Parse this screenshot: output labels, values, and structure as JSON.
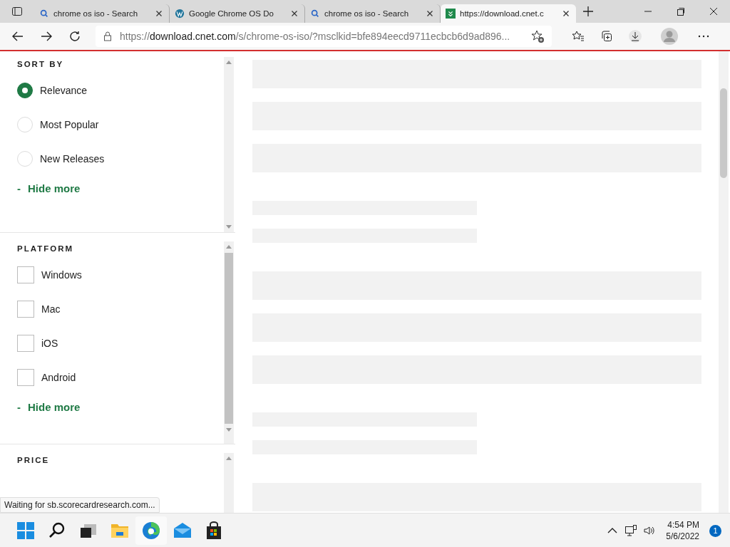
{
  "tabs": [
    {
      "title": "chrome os iso - Search",
      "kind": "search",
      "selected": false
    },
    {
      "title": "Google Chrome OS Do",
      "kind": "wordpress",
      "selected": false
    },
    {
      "title": "chrome os iso - Search",
      "kind": "search",
      "selected": false
    },
    {
      "title": "https://download.cnet.c",
      "kind": "cnet",
      "selected": true
    }
  ],
  "address": {
    "host_prefix": "https://",
    "host": "download.cnet.com",
    "rest": "/s/chrome-os-iso/?msclkid=bfe894eecd9711ecbcb6d9ad896..."
  },
  "filters": [
    {
      "title": "SORT BY",
      "kind": "radio",
      "options": [
        {
          "label": "Relevance",
          "selected": true
        },
        {
          "label": "Most Popular",
          "selected": false
        },
        {
          "label": "New Releases",
          "selected": false
        }
      ],
      "toggle": {
        "sign": "-",
        "label": "Hide more"
      }
    },
    {
      "title": "PLATFORM",
      "kind": "checkbox",
      "options": [
        {
          "label": "Windows",
          "checked": false
        },
        {
          "label": "Mac",
          "checked": false
        },
        {
          "label": "iOS",
          "checked": false
        },
        {
          "label": "Android",
          "checked": false
        }
      ],
      "toggle": {
        "sign": "-",
        "label": "Hide more"
      }
    },
    {
      "title": "PRICE"
    }
  ],
  "placeholders": [
    {
      "kind": "wide"
    },
    {
      "kind": "wide"
    },
    {
      "kind": "wide"
    },
    {
      "kind": "narrow"
    },
    {
      "kind": "narrow"
    },
    {
      "kind": "wide"
    },
    {
      "kind": "wide"
    },
    {
      "kind": "wide"
    },
    {
      "kind": "narrow"
    },
    {
      "kind": "narrow"
    },
    {
      "kind": "wide"
    }
  ],
  "status_text": "Waiting for sb.scorecardresearch.com...",
  "clock": {
    "time": "4:54 PM",
    "date": "5/6/2022",
    "badge": "1"
  }
}
